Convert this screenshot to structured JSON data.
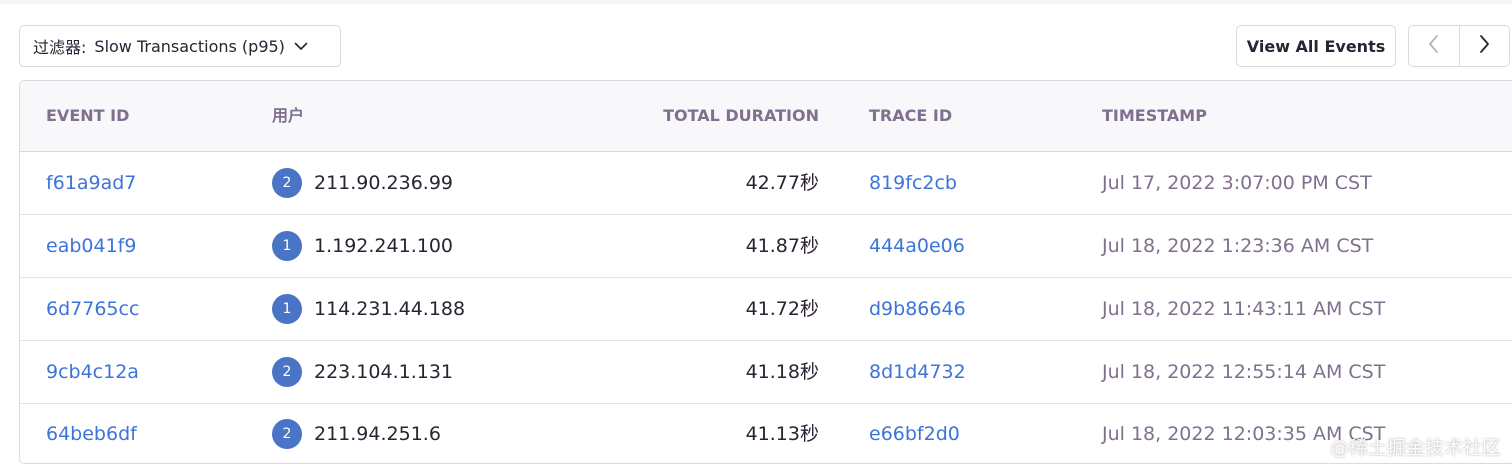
{
  "toolbar": {
    "filter_prefix": "过滤器:",
    "filter_value": "Slow Transactions (p95)",
    "view_all_label": "View All Events"
  },
  "table": {
    "headers": {
      "event_id": "EVENT ID",
      "user": "用户",
      "duration": "TOTAL DURATION",
      "trace_id": "TRACE ID",
      "timestamp": "TIMESTAMP"
    },
    "rows": [
      {
        "event_id": "f61a9ad7",
        "user_count": "2",
        "user": "211.90.236.99",
        "duration": "42.77秒",
        "trace_id": "819fc2cb",
        "timestamp": "Jul 17, 2022 3:07:00 PM CST"
      },
      {
        "event_id": "eab041f9",
        "user_count": "1",
        "user": "1.192.241.100",
        "duration": "41.87秒",
        "trace_id": "444a0e06",
        "timestamp": "Jul 18, 2022 1:23:36 AM CST"
      },
      {
        "event_id": "6d7765cc",
        "user_count": "1",
        "user": "114.231.44.188",
        "duration": "41.72秒",
        "trace_id": "d9b86646",
        "timestamp": "Jul 18, 2022 11:43:11 AM CST"
      },
      {
        "event_id": "9cb4c12a",
        "user_count": "2",
        "user": "223.104.1.131",
        "duration": "41.18秒",
        "trace_id": "8d1d4732",
        "timestamp": "Jul 18, 2022 12:55:14 AM CST"
      },
      {
        "event_id": "64beb6df",
        "user_count": "2",
        "user": "211.94.251.6",
        "duration": "41.13秒",
        "trace_id": "e66bf2d0",
        "timestamp": "Jul 18, 2022 12:03:35 AM CST"
      }
    ]
  },
  "watermark": "@稀土掘金技术社区",
  "icons": {
    "filter_chevron": "chevron-down-icon",
    "prev": "chevron-left-icon",
    "next": "chevron-right-icon"
  },
  "colors": {
    "link": "#3d74db",
    "badge": "#4a75c6",
    "header_text": "#80708f",
    "border": "#dcd8e0"
  }
}
